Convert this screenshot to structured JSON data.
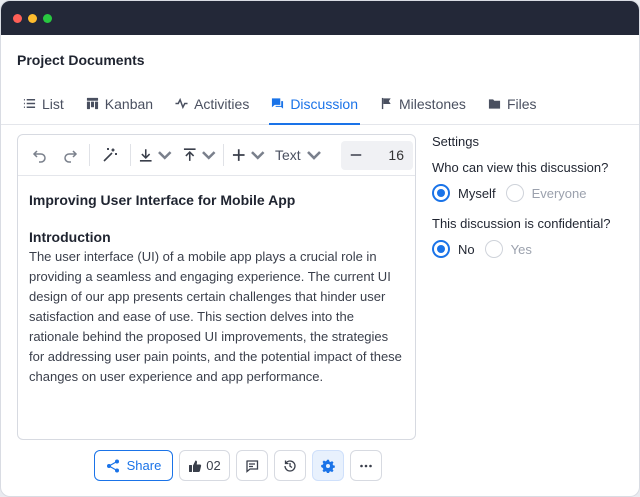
{
  "window": {
    "title": "Project Documents"
  },
  "tabs": [
    {
      "label": "List",
      "icon": "list-icon",
      "active": false
    },
    {
      "label": "Kanban",
      "icon": "kanban-icon",
      "active": false
    },
    {
      "label": "Activities",
      "icon": "activity-icon",
      "active": false
    },
    {
      "label": "Discussion",
      "icon": "chat-icon",
      "active": true
    },
    {
      "label": "Milestones",
      "icon": "flag-icon",
      "active": false
    },
    {
      "label": "Files",
      "icon": "folder-icon",
      "active": false
    }
  ],
  "toolbar": {
    "text_style": "Text",
    "font_size": "16",
    "icons": [
      "undo-icon",
      "redo-icon",
      "magic-wand-icon",
      "download-icon",
      "upload-icon",
      "plus-icon",
      "minus-icon"
    ]
  },
  "document": {
    "title": "Improving User Interface for Mobile App",
    "section_heading": "Introduction",
    "body": "The user interface (UI) of a mobile app plays a crucial role in providing a seamless and engaging experience. The current UI design of our app presents certain challenges that hinder user satisfaction and ease of use. This section delves into the rationale behind the proposed UI improvements, the strategies for addressing user pain points, and the potential impact of these changes on user experience and app performance."
  },
  "settings": {
    "title": "Settings",
    "visibility_question": "Who can view this discussion?",
    "visibility_options": [
      "Myself",
      "Everyone"
    ],
    "visibility_selected": "Myself",
    "confidential_question": "This discussion is confidential?",
    "confidential_options": [
      "No",
      "Yes"
    ],
    "confidential_selected": "No"
  },
  "actions": {
    "share_label": "Share",
    "like_count": "02"
  },
  "colors": {
    "accent": "#1a73e8",
    "titlebar": "#232838"
  }
}
